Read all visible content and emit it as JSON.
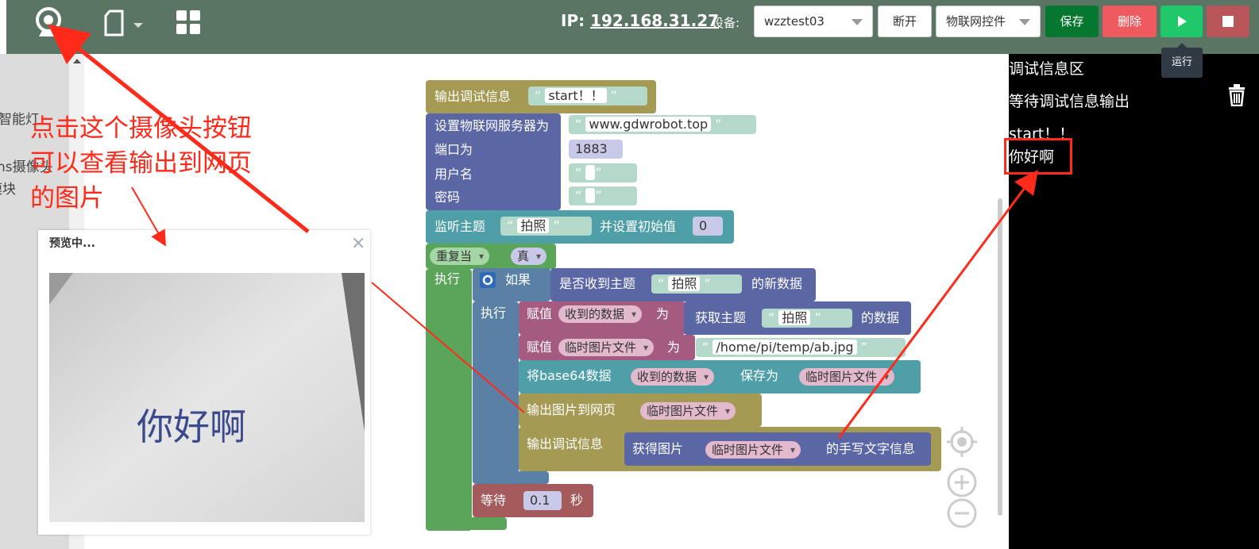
{
  "toolbar": {
    "ip_label": "IP:",
    "ip_value": "192.168.31.27",
    "device_label": "设备:",
    "device_select": "wzztest03",
    "disconnect_label": "断开",
    "control_select": "物联网控件",
    "save_label": "保存",
    "delete_label": "删除",
    "tooltip_run": "运行"
  },
  "sidebar": {
    "items": [
      "智能灯",
      "ns摄像头",
      "模块"
    ]
  },
  "annotation": {
    "lines": [
      "点击这个摄像头按钮",
      "可以查看输出到网页",
      "的图片"
    ]
  },
  "preview": {
    "title": "预览中...",
    "close": "×",
    "handwriting": "你好啊"
  },
  "blocks": {
    "print_debug": "输出调试信息",
    "print_start": "start！！",
    "set_server": "设置物联网服务器为",
    "server_value": "www.gdwrobot.top",
    "port_label": "端口为",
    "port_value": "1883",
    "username_label": "用户名",
    "password_label": "密码",
    "subscribe_label": "监听主题",
    "subscribe_topic": "拍照",
    "init_label": "并设置初始值",
    "init_value": "0",
    "repeat_label": "重复当",
    "repeat_cond": "真",
    "do_label": "执行",
    "if_label": "如果",
    "received_topic": "是否收到主题",
    "received_topic_value": "拍照",
    "new_data": "的新数据",
    "do_label2": "执行",
    "assign1": "赋值",
    "var_received": "收到的数据",
    "as1": "为",
    "get_topic": "获取主题",
    "get_topic_value": "拍照",
    "topic_data": "的数据",
    "assign2": "赋值",
    "var_tempimg": "临时图片文件",
    "as2": "为",
    "path_value": "/home/pi/temp/ab.jpg",
    "base64_save": "将base64数据",
    "base64_var": "收到的数据",
    "save_as": "保存为",
    "save_var": "临时图片文件",
    "output_image": "输出图片到网页",
    "output_image_var": "临时图片文件",
    "print_debug2": "输出调试信息",
    "get_image": "获得图片",
    "get_image_var": "临时图片文件",
    "handwriting_info": "的手写文字信息",
    "wait_label": "等待",
    "wait_value": "0.1",
    "seconds": "秒"
  },
  "debug_panel": {
    "title": "调试信息区",
    "waiting": "等待调试信息输出",
    "line1": "start！！",
    "line2": "你好啊"
  },
  "colors": {
    "topbar": "#5b7565",
    "save": "#06772f",
    "delete": "#ee5a5e",
    "run": "#1fc96a",
    "stop": "#b85659",
    "annotation": "#ff2a1a"
  }
}
